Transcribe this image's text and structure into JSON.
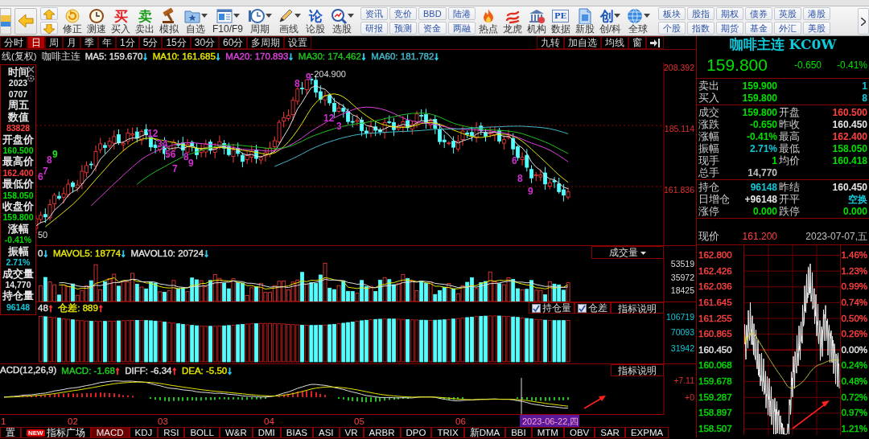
{
  "toolbar": {
    "tools": [
      {
        "label": "修正"
      },
      {
        "label": "测速"
      },
      {
        "label": "买入",
        "glyph": "买"
      },
      {
        "label": "卖出",
        "glyph": "卖"
      },
      {
        "label": "模拟"
      },
      {
        "label": "自选",
        "dropdown": true
      },
      {
        "label": "F10/F9",
        "dropdown": true
      },
      {
        "label": "周期",
        "dropdown": true
      },
      {
        "label": "画线",
        "dropdown": true
      },
      {
        "label": "论股",
        "glyph": "论"
      },
      {
        "label": "选股",
        "dropdown": true
      }
    ],
    "quick_pairs": [
      {
        "top": "资讯",
        "bottom": "研报"
      },
      {
        "top": "竞价",
        "bottom": "预测"
      },
      {
        "top": "BBD",
        "bottom": "资金"
      },
      {
        "top": "陆港",
        "bottom": "两融"
      }
    ],
    "tools_2": [
      {
        "label": "热点"
      },
      {
        "label": "龙虎"
      },
      {
        "label": "机构"
      },
      {
        "label": "数据",
        "glyph": "PE"
      },
      {
        "label": "新股"
      },
      {
        "label": "创/科",
        "glyph": "创",
        "dropdown": true
      },
      {
        "label": "全球",
        "dropdown": true
      }
    ],
    "market_pairs": [
      {
        "top": "板块",
        "bottom": "个股"
      },
      {
        "top": "股指",
        "bottom": "指数"
      },
      {
        "top": "期权",
        "bottom": "期货"
      },
      {
        "top": "债券",
        "bottom": "基金"
      },
      {
        "top": "英股",
        "bottom": "外汇"
      },
      {
        "top": "港股",
        "bottom": "美股"
      }
    ]
  },
  "period_tabs": [
    {
      "label": "分时",
      "selected": false
    },
    {
      "label": "日",
      "selected": true
    },
    {
      "label": "周",
      "selected": false
    },
    {
      "label": "月",
      "selected": false
    },
    {
      "label": "季",
      "selected": false
    },
    {
      "label": "年",
      "selected": false
    },
    {
      "label": "1分",
      "selected": false
    },
    {
      "label": "5分",
      "selected": false
    },
    {
      "label": "15分",
      "selected": false
    },
    {
      "label": "30分",
      "selected": false
    },
    {
      "label": "60分",
      "selected": false
    },
    {
      "label": "多周期",
      "selected": false
    },
    {
      "label": "设置",
      "selected": false
    }
  ],
  "chart_tools": [
    {
      "label": "九转"
    },
    {
      "label": "加自选"
    },
    {
      "label": "均线"
    },
    {
      "label": "窗"
    }
  ],
  "price_panel": {
    "title_parts": [
      "线(复权)",
      "咖啡主连"
    ],
    "legend": [
      {
        "text": "MA5: 159.670",
        "arrow": {
          "text": "↓",
          "color": "#30c8e8"
        },
        "color": "#e0e0e0"
      },
      {
        "text": "MA10: 161.685",
        "arrow": {
          "text": "↓",
          "color": "#30c8e8"
        },
        "color": "#e6e600"
      },
      {
        "text": "MA20: 170.893",
        "arrow": {
          "text": "↓",
          "color": "#30c8e8"
        },
        "color": "#e040e0"
      },
      {
        "text": "MA30: 174.462",
        "arrow": {
          "text": "↓",
          "color": "#30c8e8"
        },
        "color": "#20c020"
      },
      {
        "text": "MA60: 181.782",
        "arrow": {
          "text": "↓",
          "color": "#30c8e8"
        },
        "color": "#40b8c8"
      }
    ],
    "axis": [
      "208.392",
      "185.114",
      "161.836"
    ],
    "peak_label": "204.900",
    "edge_label": "50",
    "td_marks": [
      {
        "text": "6",
        "color": "#d030d0"
      },
      {
        "text": "7",
        "color": "#d030d0"
      },
      {
        "text": "8",
        "color": "#d030d0"
      },
      {
        "text": "9",
        "color": "#20e020"
      },
      {
        "text": "12",
        "color": "#d030d0"
      },
      {
        "text": "34",
        "color": "#d030d0"
      },
      {
        "text": "56",
        "color": "#d030d0"
      },
      {
        "text": "7",
        "color": "#d030d0"
      },
      {
        "text": "8",
        "color": "#d030d0"
      },
      {
        "text": "9",
        "color": "#d030d0"
      },
      {
        "text": "8",
        "color": "#d030d0"
      },
      {
        "text": "9",
        "color": "#d030d0"
      },
      {
        "text": "12",
        "color": "#d030d0"
      },
      {
        "text": "3",
        "color": "#d030d0"
      },
      {
        "text": "6",
        "color": "#d030d0"
      },
      {
        "text": "8",
        "color": "#d030d0"
      },
      {
        "text": "9",
        "color": "#d030d0"
      }
    ]
  },
  "info_box": {
    "items": [
      {
        "text": "时间",
        "kind": "label",
        "color": "#e6e6e6"
      },
      {
        "text": "2023",
        "kind": "value",
        "color": "#e6e6e6"
      },
      {
        "text": "0707",
        "kind": "value",
        "color": "#e6e6e6"
      },
      {
        "text": "周五",
        "kind": "label",
        "color": "#e6e6e6"
      },
      {
        "text": "数值",
        "kind": "label",
        "color": "#e6e6e6"
      },
      {
        "text": "83828",
        "kind": "value",
        "color": "#ff4040"
      },
      {
        "text": "开盘价",
        "kind": "label",
        "color": "#e6e6e6"
      },
      {
        "text": "160.500",
        "kind": "value",
        "color": "#00e000"
      },
      {
        "text": "最高价",
        "kind": "label",
        "color": "#e6e6e6"
      },
      {
        "text": "162.400",
        "kind": "value",
        "color": "#ff4040"
      },
      {
        "text": "最低价",
        "kind": "label",
        "color": "#e6e6e6"
      },
      {
        "text": "158.050",
        "kind": "value",
        "color": "#00e000"
      },
      {
        "text": "收盘价",
        "kind": "label",
        "color": "#e6e6e6"
      },
      {
        "text": "159.800",
        "kind": "value",
        "color": "#00e000"
      },
      {
        "text": "涨幅",
        "kind": "label",
        "color": "#e6e6e6"
      },
      {
        "text": "-0.41%",
        "kind": "value",
        "color": "#00e000"
      },
      {
        "text": "振幅",
        "kind": "label",
        "color": "#e6e6e6"
      },
      {
        "text": "2.71%",
        "kind": "value",
        "color": "#10c8d8"
      },
      {
        "text": "成交量",
        "kind": "label",
        "color": "#e6e6e6"
      },
      {
        "text": "14,770",
        "kind": "value",
        "color": "#e6e6e6"
      },
      {
        "text": "持仓量",
        "kind": "label",
        "color": "#e6e6e6"
      },
      {
        "text": "96148",
        "kind": "value",
        "color": "#10c8d8"
      }
    ]
  },
  "volume_panel": {
    "legend": [
      {
        "text": "0",
        "arrow": {
          "text": "↓",
          "color": "#30c8e8"
        },
        "color": "#e0e0e0"
      },
      {
        "text": "MAVOL5: 18774",
        "arrow": {
          "text": "↓",
          "color": "#30c8e8"
        },
        "color": "#e6e600"
      },
      {
        "text": "MAVOL10: 20724",
        "arrow": {
          "text": "↓",
          "color": "#30c8e8"
        },
        "color": "#e0e0e0"
      }
    ],
    "selector": "成交量",
    "axis": [
      "53519",
      "35972",
      "18425"
    ]
  },
  "oi_panel": {
    "legend": [
      {
        "text": "48",
        "arrow": {
          "text": "↑",
          "color": "#ff3030"
        },
        "color": "#e0e0e0"
      },
      {
        "text": "仓差: 889",
        "arrow": {
          "text": "↑",
          "color": "#ff3030"
        },
        "color": "#e6e600"
      }
    ],
    "toggles": [
      {
        "label": "持仓量",
        "checked": true
      },
      {
        "label": "仓差",
        "checked": true
      }
    ],
    "help": "指标说明",
    "axis": [
      "106719",
      "70093",
      "31942"
    ]
  },
  "macd_panel": {
    "legend": [
      {
        "text": "ACD(12,26,9)",
        "color": "#e0e0e0"
      },
      {
        "text": "MACD: -1.68",
        "arrow": {
          "text": "↑",
          "color": "#ff3030"
        },
        "color": "#20d020"
      },
      {
        "text": "DIFF: -6.34",
        "arrow": {
          "text": "↑",
          "color": "#ff3030"
        },
        "color": "#e0e0e0"
      },
      {
        "text": "DEA: -5.50",
        "arrow": {
          "text": "↓",
          "color": "#30c8e8"
        },
        "color": "#e6e600"
      }
    ],
    "help": "指标说明",
    "axis": [
      "+7.11",
      "+0"
    ]
  },
  "x_axis": {
    "labels": [
      "1",
      "02",
      "03",
      "04",
      "05",
      "06"
    ],
    "cursor_date": "2023-06-22,四"
  },
  "indicator_tabs": [
    {
      "label": "置",
      "selected": false
    },
    {
      "label": "指标广场",
      "badge": "NEW",
      "selected": false
    },
    {
      "label": "MACD",
      "selected": true
    },
    {
      "label": "KDJ",
      "selected": false
    },
    {
      "label": "RSI",
      "selected": false
    },
    {
      "label": "BOLL",
      "selected": false
    },
    {
      "label": "W&R",
      "selected": false
    },
    {
      "label": "DMI",
      "selected": false
    },
    {
      "label": "BIAS",
      "selected": false
    },
    {
      "label": "ASI",
      "selected": false
    },
    {
      "label": "VR",
      "selected": false
    },
    {
      "label": "ARBR",
      "selected": false
    },
    {
      "label": "DPO",
      "selected": false
    },
    {
      "label": "TRIX",
      "selected": false
    },
    {
      "label": "新DMA",
      "selected": false
    },
    {
      "label": "BBI",
      "selected": false
    },
    {
      "label": "MTM",
      "selected": false
    },
    {
      "label": "OBV",
      "selected": false
    },
    {
      "label": "SAR",
      "selected": false
    },
    {
      "label": "EXPMA",
      "selected": false
    }
  ],
  "quote": {
    "title": "咖啡主连 KC0W",
    "last": {
      "text": "159.800",
      "color": "#00e000"
    },
    "change": {
      "text": "-0.650",
      "color": "#00e000"
    },
    "change_pct": {
      "text": "-0.41%",
      "color": "#00e000"
    },
    "book": [
      {
        "label": "卖出",
        "price": "159.900",
        "qty": "1",
        "color": "#00e000"
      },
      {
        "label": "买入",
        "price": "159.800",
        "qty": "8",
        "color": "#00e000"
      }
    ],
    "stats": [
      {
        "label": "成交",
        "value": "159.800",
        "color": "#00e000",
        "right": {
          "label": "开盘",
          "value": "160.500",
          "color": "#ff4040"
        }
      },
      {
        "label": "涨跌",
        "value": "-0.650",
        "color": "#00e000",
        "right": {
          "label": "昨收",
          "value": "160.450",
          "color": "#e6e6e6"
        }
      },
      {
        "label": "涨幅",
        "value": "-0.41%",
        "color": "#00e000",
        "right": {
          "label": "最高",
          "value": "162.400",
          "color": "#ff4040"
        }
      },
      {
        "label": "振幅",
        "value": "2.71%",
        "color": "#10c8d8",
        "right": {
          "label": "最低",
          "value": "158.050",
          "color": "#00e000"
        }
      },
      {
        "label": "现手",
        "value": "1",
        "color": "#00e000",
        "right": {
          "label": "均价",
          "value": "160.418",
          "color": "#00e000"
        }
      },
      {
        "label": "总手",
        "value": "14,770",
        "color": "#c0c0c0"
      }
    ],
    "positions": [
      {
        "label": "持仓",
        "value": "96148",
        "color": "#10c8d8",
        "right": {
          "label": "昨结",
          "value": "160.450",
          "color": "#e6e6e6"
        }
      },
      {
        "label": "日增仓",
        "value": "+96148",
        "color": "#e6e6e6",
        "right": {
          "label": "开平",
          "value": "空换",
          "color": "#10c8d8"
        }
      },
      {
        "label": "涨停",
        "value": "0.000",
        "color": "#00e000",
        "right": {
          "label": "跌停",
          "value": "0.000",
          "color": "#00e000"
        }
      }
    ],
    "current": {
      "label": "现价",
      "value": "161.200",
      "color": "#ff4040",
      "date": "2023-07-07,五"
    }
  },
  "intraday": {
    "price_axis": [
      {
        "text": "162.800",
        "color": "#ff4040"
      },
      {
        "text": "162.426",
        "color": "#ff4040"
      },
      {
        "text": "162.036",
        "color": "#ff4040"
      },
      {
        "text": "161.645",
        "color": "#ff4040"
      },
      {
        "text": "161.255",
        "color": "#ff4040"
      },
      {
        "text": "160.865",
        "color": "#ff4040"
      },
      {
        "text": "160.450",
        "color": "#e6e6e6"
      },
      {
        "text": "160.068",
        "color": "#00e000"
      },
      {
        "text": "159.678",
        "color": "#00e000"
      },
      {
        "text": "159.287",
        "color": "#00e000"
      },
      {
        "text": "158.897",
        "color": "#00e000"
      },
      {
        "text": "158.507",
        "color": "#00e000"
      }
    ],
    "pct_axis": [
      {
        "text": "1.46%",
        "color": "#ff4040"
      },
      {
        "text": "1.23%",
        "color": "#ff4040"
      },
      {
        "text": "0.99%",
        "color": "#ff4040"
      },
      {
        "text": "0.74%",
        "color": "#ff4040"
      },
      {
        "text": "0.50%",
        "color": "#ff4040"
      },
      {
        "text": "0.26%",
        "color": "#ff4040"
      },
      {
        "text": "0.00%",
        "color": "#e6e6e6"
      },
      {
        "text": "0.24%",
        "color": "#00e000"
      },
      {
        "text": "0.48%",
        "color": "#00e000"
      },
      {
        "text": "0.72%",
        "color": "#00e000"
      },
      {
        "text": "0.97%",
        "color": "#00e000"
      },
      {
        "text": "1.21%",
        "color": "#00e000"
      }
    ]
  }
}
